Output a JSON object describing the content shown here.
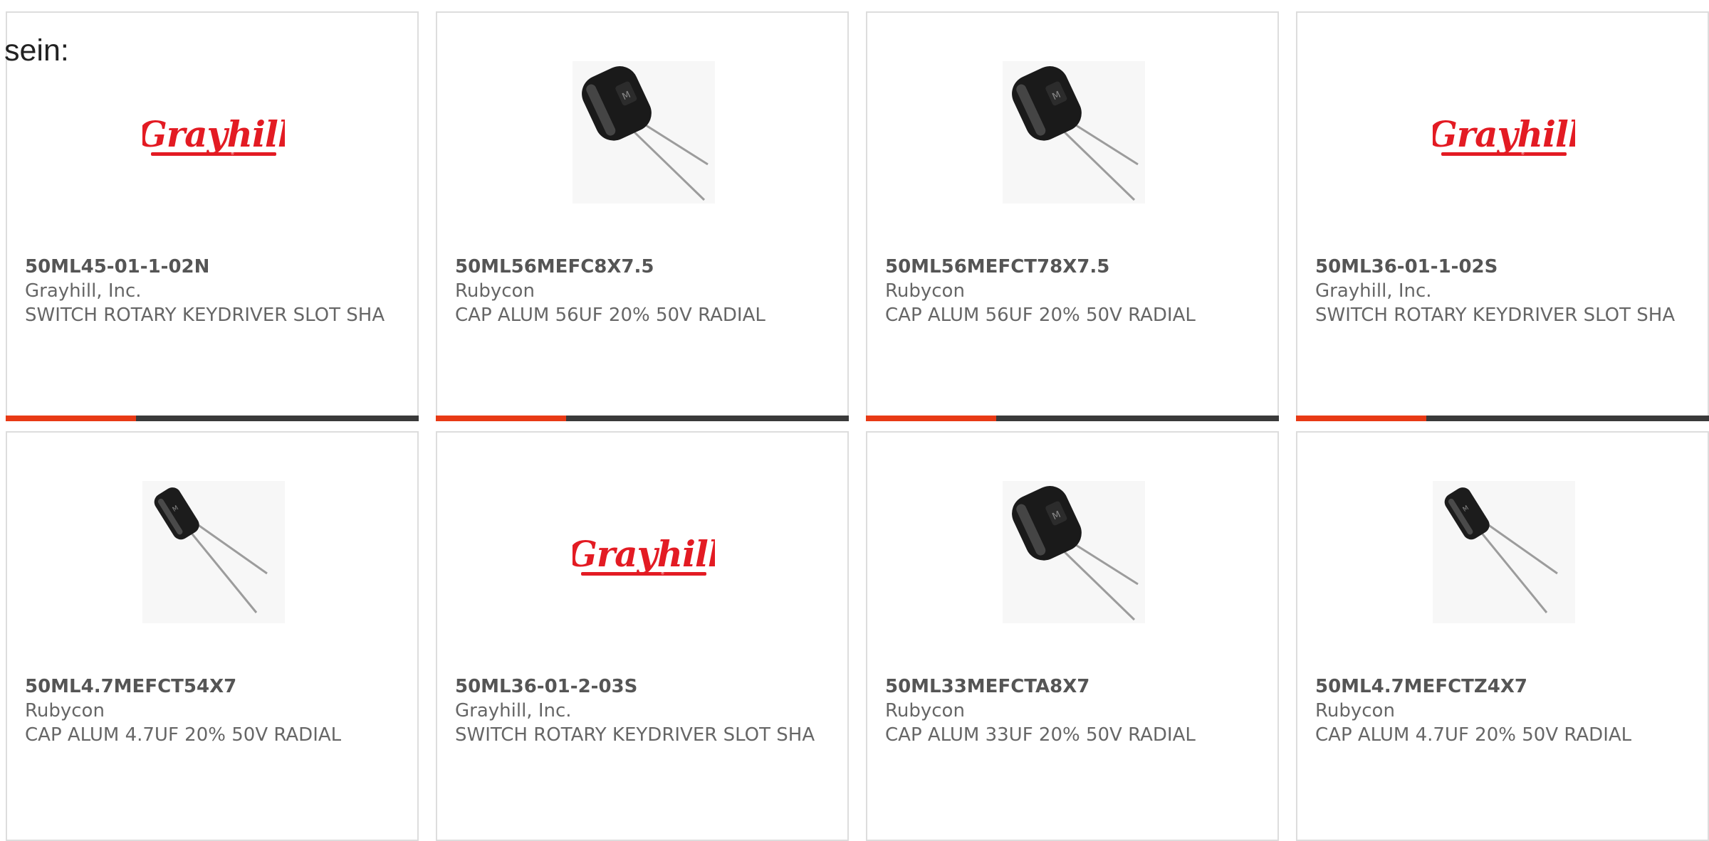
{
  "intro_text": "sein:",
  "colors": {
    "brand_red": "#e31b23",
    "accent_orange": "#e83a15",
    "bar_dark": "#3a3a3a",
    "text_gray": "#666666"
  },
  "products": [
    {
      "part_number": "50ML45-01-1-02N",
      "manufacturer": "Grayhill, Inc.",
      "description": "SWITCH ROTARY KEYDRIVER SLOT SHA",
      "image": "grayhill-logo",
      "has_bar": true
    },
    {
      "part_number": "50ML56MEFC8X7.5",
      "manufacturer": "Rubycon",
      "description": "CAP ALUM 56UF 20% 50V RADIAL",
      "image": "capacitor-large",
      "has_bar": true
    },
    {
      "part_number": "50ML56MEFCT78X7.5",
      "manufacturer": "Rubycon",
      "description": "CAP ALUM 56UF 20% 50V RADIAL",
      "image": "capacitor-large",
      "has_bar": true
    },
    {
      "part_number": "50ML36-01-1-02S",
      "manufacturer": "Grayhill, Inc.",
      "description": "SWITCH ROTARY KEYDRIVER SLOT SHA",
      "image": "grayhill-logo",
      "has_bar": true
    },
    {
      "part_number": "50ML4.7MEFCT54X7",
      "manufacturer": "Rubycon",
      "description": "CAP ALUM 4.7UF 20% 50V RADIAL",
      "image": "capacitor-small",
      "has_bar": false
    },
    {
      "part_number": "50ML36-01-2-03S",
      "manufacturer": "Grayhill, Inc.",
      "description": "SWITCH ROTARY KEYDRIVER SLOT SHA",
      "image": "grayhill-logo",
      "has_bar": false
    },
    {
      "part_number": "50ML33MEFCTA8X7",
      "manufacturer": "Rubycon",
      "description": "CAP ALUM 33UF 20% 50V RADIAL",
      "image": "capacitor-large",
      "has_bar": false
    },
    {
      "part_number": "50ML4.7MEFCTZ4X7",
      "manufacturer": "Rubycon",
      "description": "CAP ALUM 4.7UF 20% 50V RADIAL",
      "image": "capacitor-small",
      "has_bar": false
    }
  ],
  "logo": {
    "word": "Grayhill",
    "tag": "®"
  }
}
